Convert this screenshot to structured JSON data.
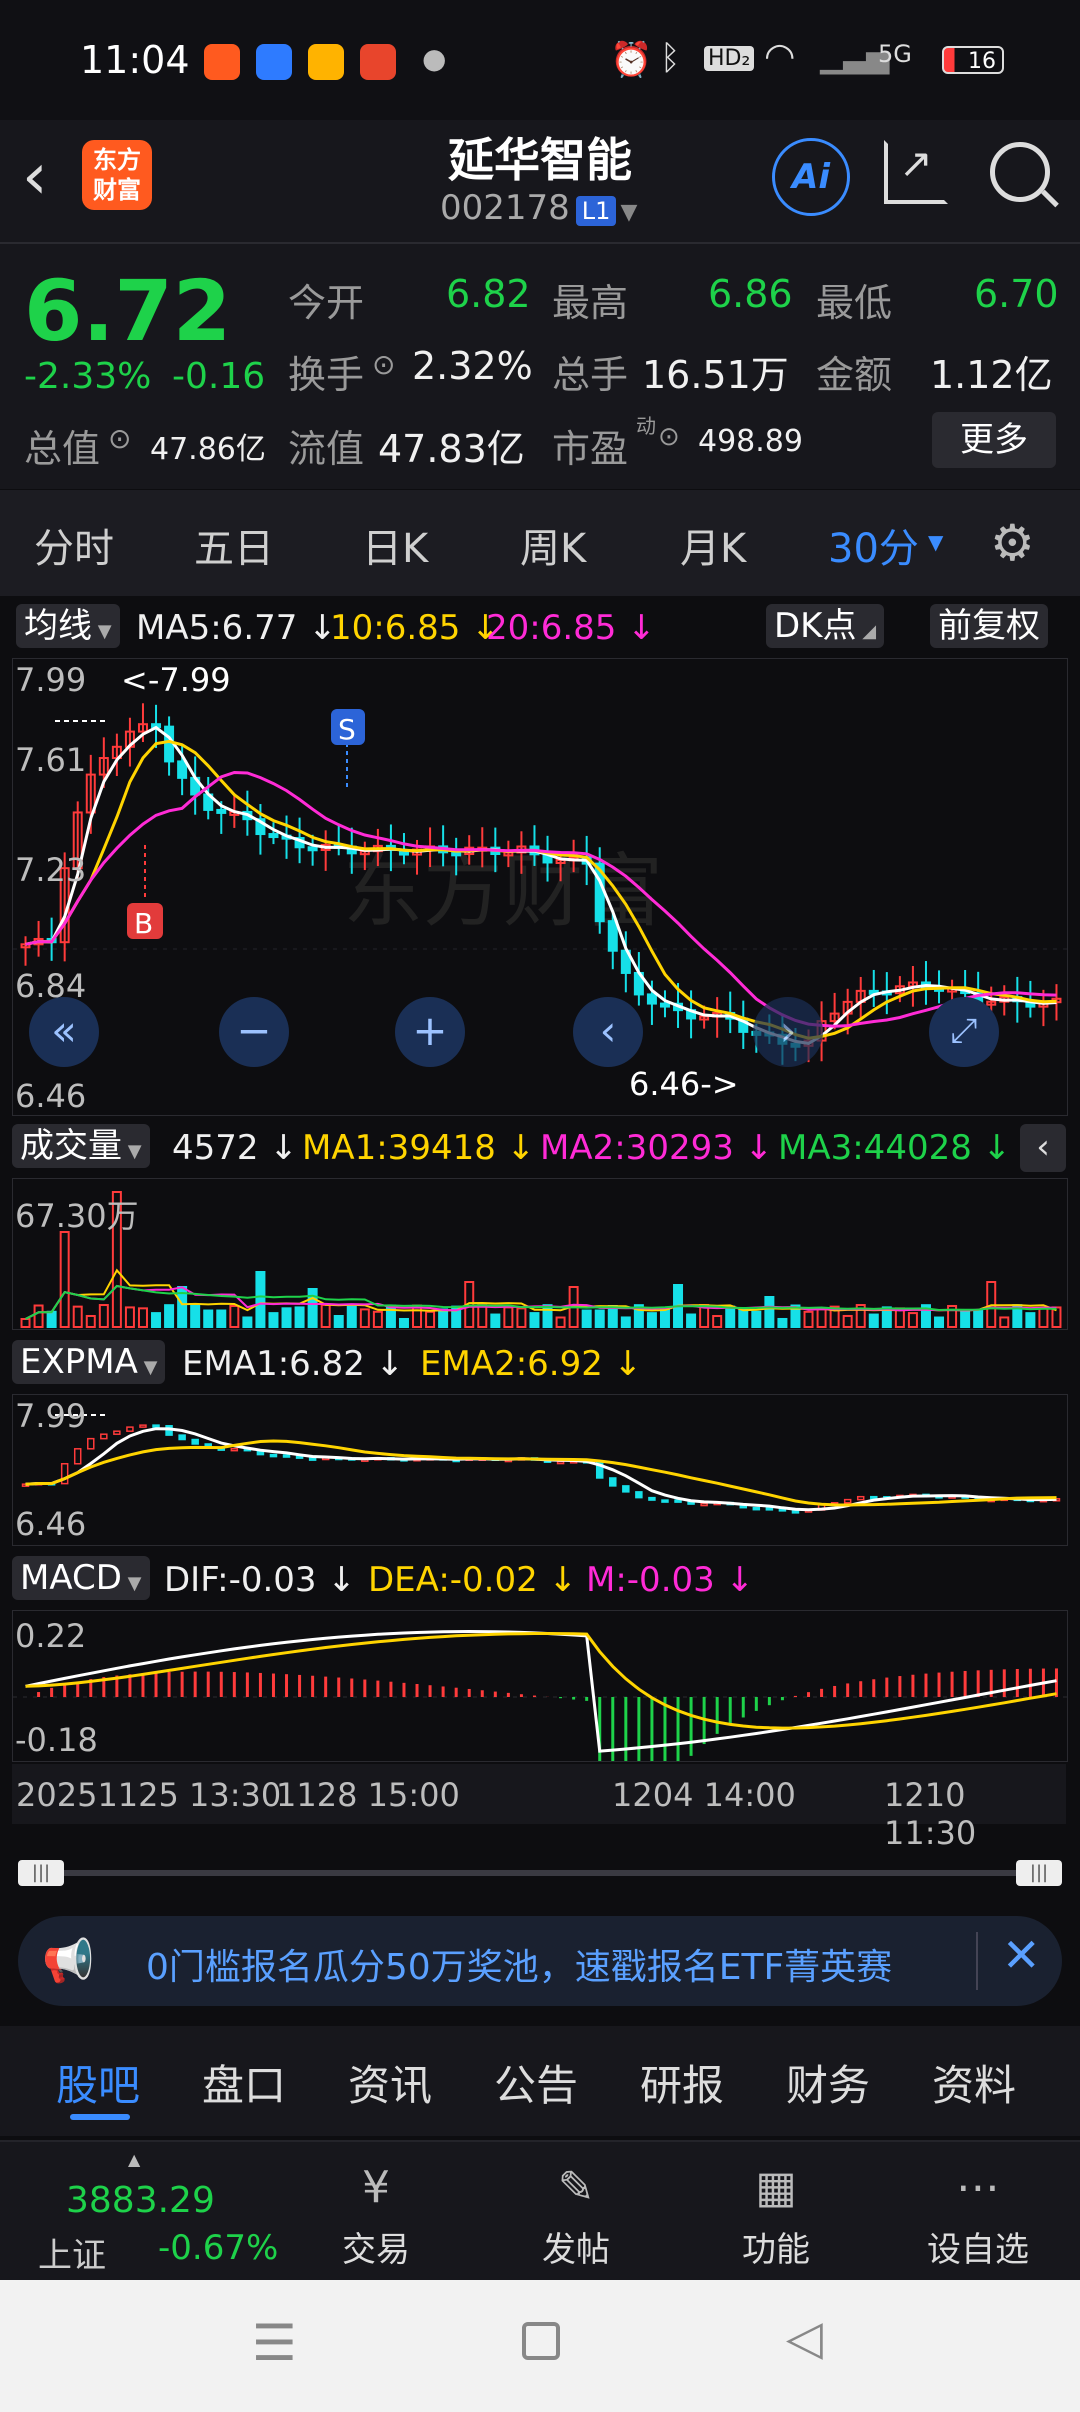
{
  "status_bar": {
    "time": "11:04",
    "battery": "16",
    "signal_label": "5G",
    "hd_label": "HD₂"
  },
  "header": {
    "logo_line1": "东方",
    "logo_line2": "财富",
    "stock_name": "延华智能",
    "stock_code": "002178",
    "level_badge": "L1",
    "ai_label": "Ai"
  },
  "quote": {
    "price": "6.72",
    "change_pct": "-2.33%",
    "change": "-0.16",
    "open_label": "今开",
    "open": "6.82",
    "high_label": "最高",
    "high": "6.86",
    "low_label": "最低",
    "low": "6.70",
    "turnover_label": "换手",
    "turnover": "2.32%",
    "volume_label": "总手",
    "volume": "16.51万",
    "amount_label": "金额",
    "amount": "1.12亿",
    "mktcap_label": "总值",
    "mktcap": "47.86亿",
    "float_label": "流值",
    "float_cap": "47.83亿",
    "pe_label": "市盈",
    "pe_sup": "动",
    "pe": "498.89",
    "more_button": "更多"
  },
  "period_tabs": [
    "分时",
    "五日",
    "日K",
    "周K",
    "月K",
    "30分"
  ],
  "ma_row": {
    "chip": "均线",
    "ma5": "MA5:6.77",
    "ma10": "10:6.85",
    "ma20": "20:6.85",
    "dk_button": "DK点",
    "adjust_button": "前复权"
  },
  "kline": {
    "y_labels": [
      "7.99",
      "7.61",
      "7.23",
      "6.84",
      "6.46"
    ],
    "max_label": "<-7.99",
    "min_label": "6.46->",
    "buy_mark": "B",
    "sell_mark": "S",
    "watermark": "东方财富"
  },
  "volume_row": {
    "chip": "成交量",
    "vol": "4572",
    "ma1": "MA1:39418",
    "ma2": "MA2:30293",
    "ma3": "MA3:44028",
    "y_label": "67.30万"
  },
  "expma_row": {
    "chip": "EXPMA",
    "ema1": "EMA1:6.82",
    "ema2": "EMA2:6.92",
    "y_top": "7.99",
    "y_bottom": "6.46"
  },
  "macd_row": {
    "chip": "MACD",
    "dif": "DIF:-0.03",
    "dea": "DEA:-0.02",
    "m": "M:-0.03",
    "y_top": "0.22",
    "y_bottom": "-0.18"
  },
  "time_axis": [
    "20251125 13:30",
    "1128 15:00",
    "1204 14:00",
    "1210 11:30"
  ],
  "banner": {
    "text": "0门槛报名瓜分50万奖池，速戳报名ETF菁英赛"
  },
  "bottom_tabs": [
    "股吧",
    "盘口",
    "资讯",
    "公告",
    "研报",
    "财务",
    "资料"
  ],
  "toolbar": {
    "index_value": "3883.29",
    "index_name": "上证",
    "index_change": "-0.67%",
    "items": [
      {
        "icon": "¥",
        "label": "交易"
      },
      {
        "icon": "✎",
        "label": "发帖"
      },
      {
        "icon": "▦",
        "label": "功能"
      },
      {
        "icon": "⋯",
        "label": "设自选"
      }
    ]
  },
  "colors": {
    "up": "#ff3b3b",
    "down": "#16e0e8",
    "ma5": "#ffffff",
    "ma10": "#ffd400",
    "ma20": "#ff2bd6",
    "accent": "#3a8cff"
  }
}
